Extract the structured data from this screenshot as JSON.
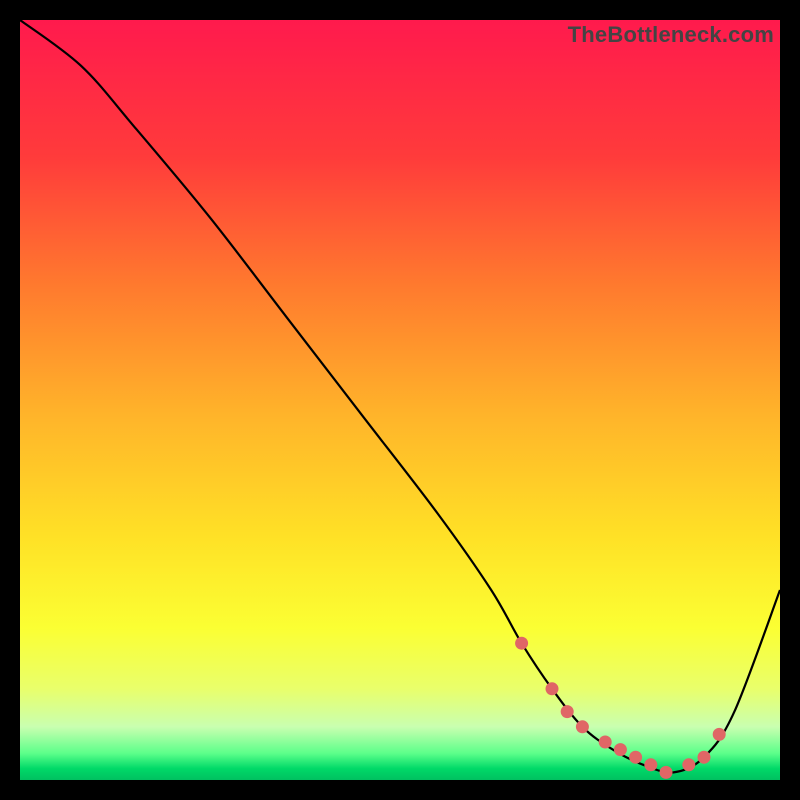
{
  "watermark": "TheBottleneck.com",
  "colors": {
    "stops": [
      {
        "offset": 0.0,
        "color": "#ff1a4d"
      },
      {
        "offset": 0.18,
        "color": "#ff3b3b"
      },
      {
        "offset": 0.35,
        "color": "#ff7a2e"
      },
      {
        "offset": 0.52,
        "color": "#ffb42a"
      },
      {
        "offset": 0.68,
        "color": "#ffe126"
      },
      {
        "offset": 0.8,
        "color": "#fbff33"
      },
      {
        "offset": 0.88,
        "color": "#e9ff6b"
      },
      {
        "offset": 0.93,
        "color": "#c9ffb0"
      },
      {
        "offset": 0.965,
        "color": "#5cff8a"
      },
      {
        "offset": 0.985,
        "color": "#00d968"
      },
      {
        "offset": 1.0,
        "color": "#00c060"
      }
    ],
    "curve_stroke": "#000000",
    "marker_fill": "#e06666",
    "marker_stroke": "#b24848"
  },
  "chart_data": {
    "type": "line",
    "title": "",
    "xlabel": "",
    "ylabel": "",
    "xlim": [
      0,
      100
    ],
    "ylim": [
      0,
      100
    ],
    "series": [
      {
        "name": "bottleneck-curve",
        "x": [
          0,
          8,
          15,
          25,
          35,
          45,
          55,
          62,
          66,
          70,
          74,
          78,
          82,
          86,
          90,
          94,
          100
        ],
        "y": [
          100,
          94,
          86,
          74,
          61,
          48,
          35,
          25,
          18,
          12,
          7,
          4,
          2,
          1,
          3,
          9,
          25
        ]
      }
    ],
    "markers": {
      "name": "highlighted-points",
      "x": [
        66,
        70,
        72,
        74,
        77,
        79,
        81,
        83,
        85,
        88,
        90,
        92
      ],
      "y": [
        18,
        12,
        9,
        7,
        5,
        4,
        3,
        2,
        1,
        2,
        3,
        6
      ]
    }
  }
}
